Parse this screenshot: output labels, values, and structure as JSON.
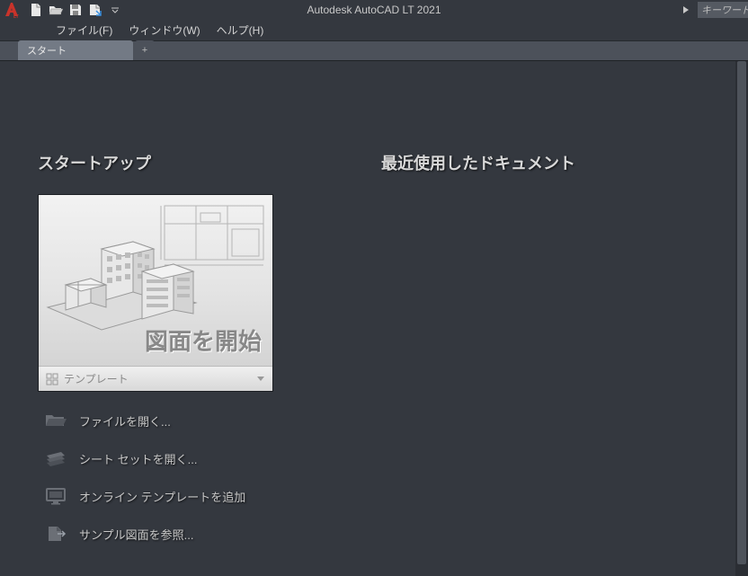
{
  "titlebar": {
    "app_title": "Autodesk AutoCAD LT 2021",
    "search_placeholder": "キーワードまた"
  },
  "menus": {
    "file": "ファイル(F)",
    "window": "ウィンドウ(W)",
    "help": "ヘルプ(H)"
  },
  "tabs": {
    "start": "スタート",
    "add": "+"
  },
  "start": {
    "startup_title": "スタートアップ",
    "start_drawing": "図面を開始",
    "template_label": "テンプレート",
    "actions": {
      "open_file": "ファイルを開く...",
      "open_sheetset": "シート セットを開く...",
      "add_online_template": "オンライン テンプレートを追加",
      "browse_sample": "サンプル図面を参照..."
    },
    "recent_title": "最近使用したドキュメント"
  }
}
